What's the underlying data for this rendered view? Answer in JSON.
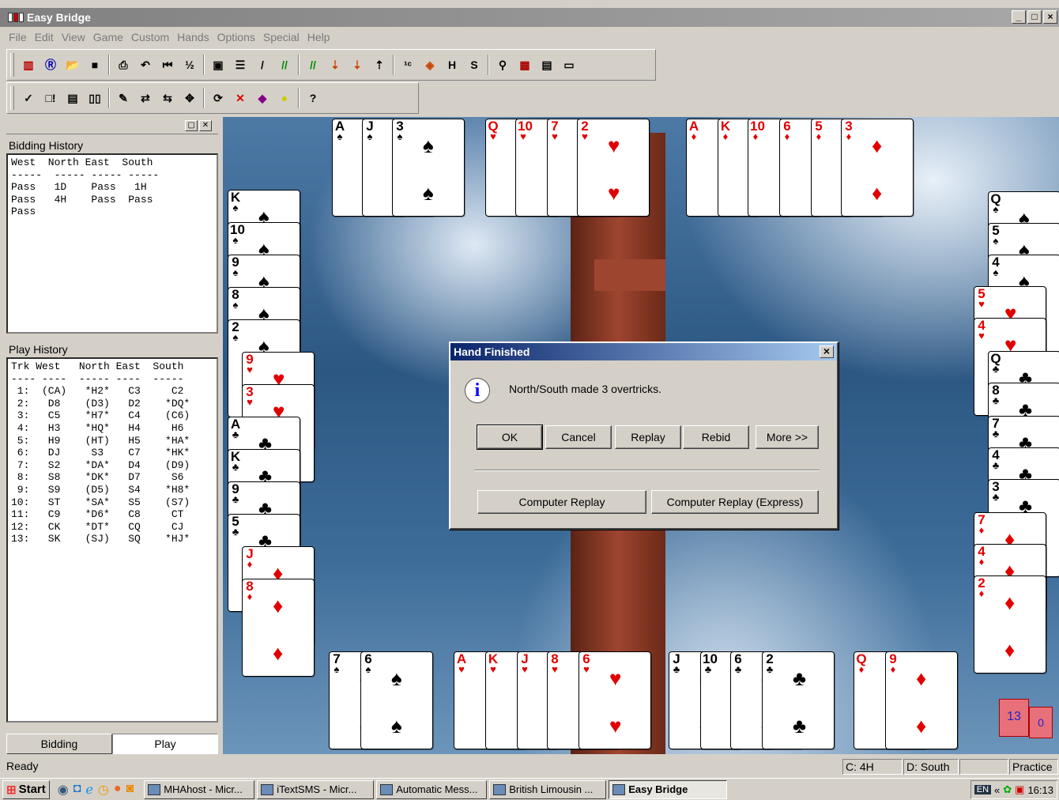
{
  "window": {
    "title": "Easy Bridge",
    "controls": [
      "_",
      "□",
      "×"
    ]
  },
  "menu": [
    "File",
    "Edit",
    "View",
    "Game",
    "Custom",
    "Hands",
    "Options",
    "Special",
    "Help"
  ],
  "toolbar1": [
    "new-game",
    "bridge-r",
    "open",
    "save",
    "print",
    "undo",
    "rewind",
    "bid-1c2d",
    "claim",
    "review",
    "pencil",
    "double",
    "redouble",
    "deal-1",
    "deal-2",
    "deal-3",
    "bid-1c",
    "rotate",
    "hint-h",
    "hint-s",
    "analysis",
    "cards",
    "memo",
    "window"
  ],
  "toolbar2": [
    "check",
    "expand",
    "script",
    "split",
    "edit",
    "swap",
    "swap2",
    "move",
    "refresh",
    "stop",
    "book",
    "bulb",
    "help"
  ],
  "left": {
    "bidding_label": "Bidding History",
    "bidding_header": "West  North East  South",
    "bidding_dashes": "-----  ----- ----- -----",
    "bidding_rows": [
      "Pass   1D    Pass   1H",
      "Pass   4H    Pass  Pass",
      "Pass"
    ],
    "play_label": "Play History",
    "play_header": "Trk West   North East  South",
    "play_dashes": "---- ----  ----- ----  -----",
    "play_rows": [
      " 1:  (CA)   *H2*   C3     C2",
      " 2:   D8    (D3)   D2    *DQ*",
      " 3:   C5    *H7*   C4    (C6)",
      " 4:   H3    *HQ*   H4     H6",
      " 5:   H9    (HT)   H5    *HA*",
      " 6:   DJ     S3    C7    *HK*",
      " 7:   S2    *DA*   D4    (D9)",
      " 8:   S8    *DK*   D7     S6",
      " 9:   S9    (D5)   S4    *H8*",
      "10:   ST    *SA*   S5    (S7)",
      "11:   C9    *D6*   C8     CT",
      "12:   CK    *DT*   CQ     CJ",
      "13:   SK    (SJ)   SQ    *HJ*"
    ],
    "tabs": [
      "Bidding",
      "Play"
    ]
  },
  "dialog": {
    "title": "Hand Finished",
    "message": "North/South made 3 overtricks.",
    "buttons": [
      "OK",
      "Cancel",
      "Replay",
      "Rebid",
      "More >>"
    ],
    "buttons2": [
      "Computer Replay",
      "Computer Replay (Express)"
    ]
  },
  "north_cards": [
    {
      "r": "A",
      "s": "♠"
    },
    {
      "r": "J",
      "s": "♠"
    },
    {
      "r": "3",
      "s": "♠"
    },
    {
      "r": "Q",
      "s": "♥"
    },
    {
      "r": "10",
      "s": "♥"
    },
    {
      "r": "7",
      "s": "♥"
    },
    {
      "r": "2",
      "s": "♥"
    },
    {
      "r": "A",
      "s": "♦"
    },
    {
      "r": "K",
      "s": "♦"
    },
    {
      "r": "10",
      "s": "♦"
    },
    {
      "r": "6",
      "s": "♦"
    },
    {
      "r": "5",
      "s": "♦"
    },
    {
      "r": "3",
      "s": "♦"
    }
  ],
  "west_cards": [
    {
      "r": "K",
      "s": "♠"
    },
    {
      "r": "10",
      "s": "♠"
    },
    {
      "r": "9",
      "s": "♠"
    },
    {
      "r": "8",
      "s": "♠"
    },
    {
      "r": "2",
      "s": "♠"
    },
    {
      "r": "9",
      "s": "♥"
    },
    {
      "r": "3",
      "s": "♥"
    },
    {
      "r": "A",
      "s": "♣"
    },
    {
      "r": "K",
      "s": "♣"
    },
    {
      "r": "9",
      "s": "♣"
    },
    {
      "r": "5",
      "s": "♣"
    },
    {
      "r": "J",
      "s": "♦"
    },
    {
      "r": "8",
      "s": "♦"
    }
  ],
  "south_cards": [
    {
      "r": "7",
      "s": "♠"
    },
    {
      "r": "6",
      "s": "♠"
    },
    {
      "r": "A",
      "s": "♥"
    },
    {
      "r": "K",
      "s": "♥"
    },
    {
      "r": "J",
      "s": "♥"
    },
    {
      "r": "8",
      "s": "♥"
    },
    {
      "r": "6",
      "s": "♥"
    },
    {
      "r": "J",
      "s": "♣"
    },
    {
      "r": "10",
      "s": "♣"
    },
    {
      "r": "6",
      "s": "♣"
    },
    {
      "r": "2",
      "s": "♣"
    },
    {
      "r": "Q",
      "s": "♦"
    },
    {
      "r": "9",
      "s": "♦"
    }
  ],
  "east_cards": [
    {
      "r": "Q",
      "s": "♠"
    },
    {
      "r": "5",
      "s": "♠"
    },
    {
      "r": "4",
      "s": "♠"
    },
    {
      "r": "5",
      "s": "♥"
    },
    {
      "r": "4",
      "s": "♥"
    },
    {
      "r": "Q",
      "s": "♣"
    },
    {
      "r": "8",
      "s": "♣"
    },
    {
      "r": "7",
      "s": "♣"
    },
    {
      "r": "4",
      "s": "♣"
    },
    {
      "r": "3",
      "s": "♣"
    },
    {
      "r": "7",
      "s": "♦"
    },
    {
      "r": "4",
      "s": "♦"
    },
    {
      "r": "2",
      "s": "♦"
    }
  ],
  "score": {
    "ns": "13",
    "ew": "0"
  },
  "status": {
    "text": "Ready",
    "contract": "C: 4H",
    "declarer": "D: South",
    "mode": "Practice"
  },
  "taskbar": {
    "start": "Start",
    "items": [
      "MHAhost - Micr...",
      "iTextSMS - Micr...",
      "Automatic Mess...",
      "British Limousin ...",
      "Easy Bridge"
    ],
    "lang": "EN",
    "time": "16:13"
  }
}
